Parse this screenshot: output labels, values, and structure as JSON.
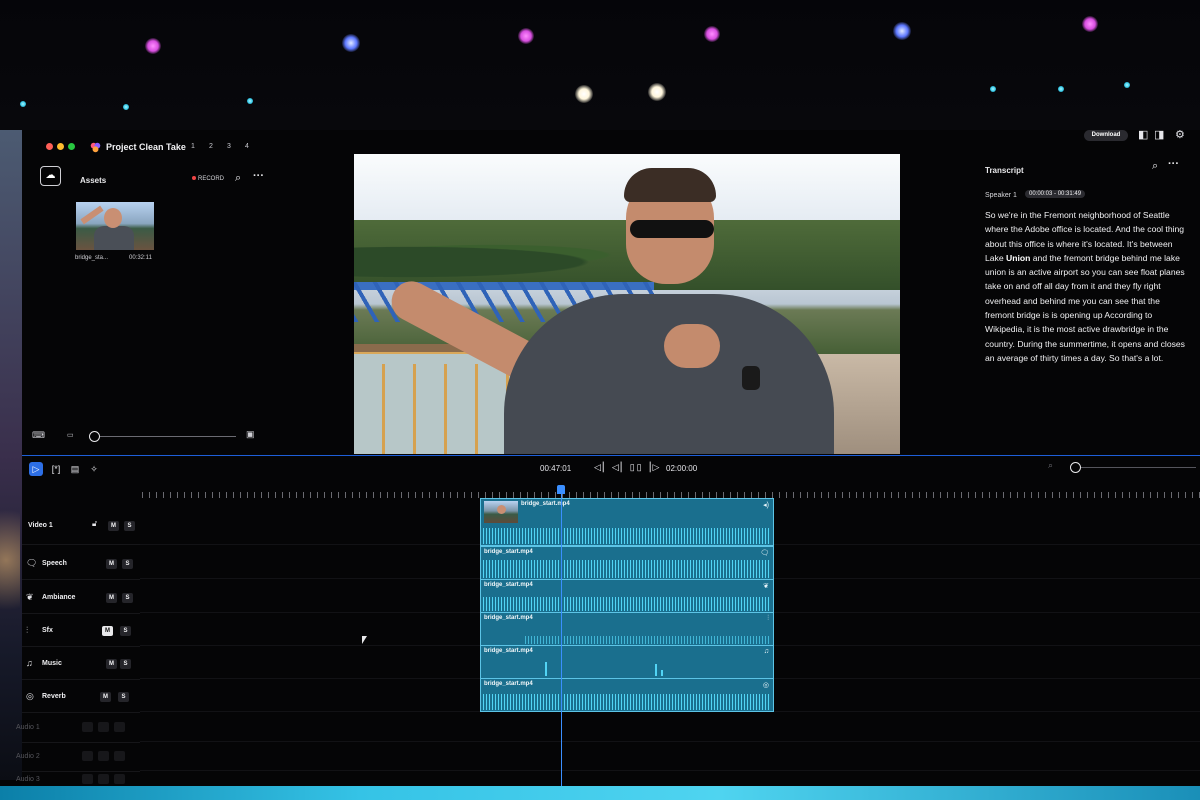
{
  "window": {
    "project_title": "Project Clean Take",
    "tabs": [
      "1",
      "2",
      "3",
      "4"
    ],
    "download_label": "Download"
  },
  "assets": {
    "title": "Assets",
    "record_label": "RECORD",
    "items": [
      {
        "name": "bridge_sta...",
        "duration": "00:32:11"
      }
    ]
  },
  "transcript": {
    "title": "Transcript",
    "speaker": "Speaker 1",
    "time_range": "00:00:03 - 00:31:49",
    "text_before": "So we're in the Fremont neighborhood of Seattle where the Adobe office is located. And the cool thing about this office is where it's located. It's between Lake ",
    "text_bold": "Union",
    "text_after": " and the fremont bridge behind me lake union is an active airport so you can see float planes take on and off all day from it and they fly right overhead and behind me you can see that the fremont bridge is is opening up According to Wikipedia, it is the most active drawbridge in the country. During the summertime, it opens and closes an average of thirty times a day. So that's a lot."
  },
  "timeline": {
    "current_time": "00:47:01",
    "total_time": "02:00:00",
    "tracks": [
      {
        "label": "Video 1",
        "icon": "",
        "mute": "M",
        "solo": "S"
      },
      {
        "label": "Speech",
        "icon": "speech-icon",
        "mute": "M",
        "solo": "S"
      },
      {
        "label": "Ambiance",
        "icon": "leaf-icon",
        "mute": "M",
        "solo": "S"
      },
      {
        "label": "Sfx",
        "icon": "waveform-icon",
        "mute": "M",
        "solo": "S"
      },
      {
        "label": "Music",
        "icon": "music-note-icon",
        "mute": "M",
        "solo": "S"
      },
      {
        "label": "Reverb",
        "icon": "reverb-icon",
        "mute": "M",
        "solo": "S"
      },
      {
        "label": "Audio 1",
        "icon": "",
        "mute": "",
        "solo": ""
      },
      {
        "label": "Audio 2",
        "icon": "",
        "mute": "",
        "solo": ""
      },
      {
        "label": "Audio 3",
        "icon": "",
        "mute": "",
        "solo": ""
      }
    ],
    "clips": [
      {
        "track": "Video 1",
        "name": "bridge_start.mp4"
      },
      {
        "track": "Speech",
        "name": "bridge_start.mp4"
      },
      {
        "track": "Ambiance",
        "name": "bridge_start.mp4"
      },
      {
        "track": "Sfx",
        "name": "bridge_start.mp4"
      },
      {
        "track": "Music",
        "name": "bridge_start.mp4"
      },
      {
        "track": "Reverb",
        "name": "bridge_start.mp4"
      }
    ]
  },
  "colors": {
    "accent": "#2d6fe6",
    "clip_fill": "#1a6f8e",
    "waveform": "#52d4f5",
    "playhead": "#3b8fff"
  }
}
